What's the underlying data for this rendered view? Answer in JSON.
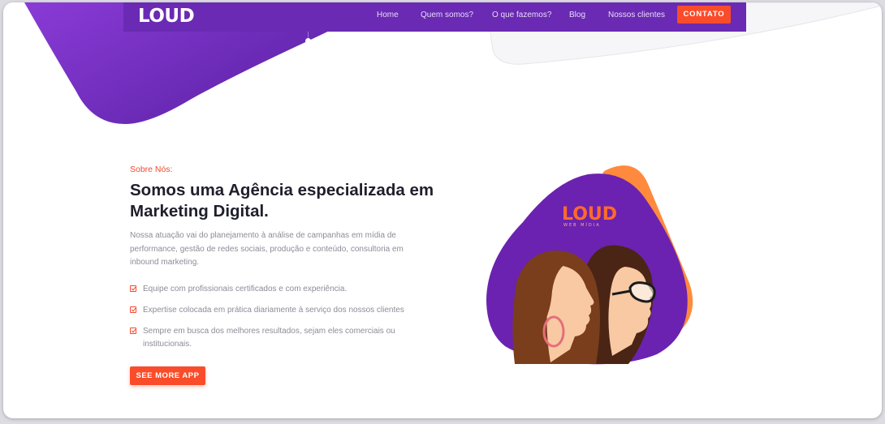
{
  "brand": {
    "logo_text": "LOUD"
  },
  "nav": {
    "items": [
      "Home",
      "Quem somos?",
      "O que fazemos?",
      "Blog",
      "Nossos clientes"
    ],
    "contact_label": "CONTATO"
  },
  "about": {
    "eyebrow": "Sobre Nós:",
    "title": "Somos uma Agência especializada em Marketing Digital.",
    "description": "Nossa atuação vai do planejamento à análise de campanhas em mídia de performance, gestão de redes sociais, produção e conteúdo, consultoria em inbound marketing.",
    "features": [
      "Equipe com profissionais certificados e com experiência.",
      "Expertise colocada em prática diariamente à serviço dos nossos clientes",
      "Sempre em busca dos melhores resultados, sejam eles comerciais ou institucionais."
    ],
    "cta_label": "SEE MORE APP"
  },
  "illustration": {
    "logo_text": "LOUD",
    "logo_sub": "WEB MÍDIA"
  },
  "colors": {
    "purple": "#6a2ab3",
    "accent": "#fa4c2a",
    "orange_blob": "#ff8a3d"
  }
}
